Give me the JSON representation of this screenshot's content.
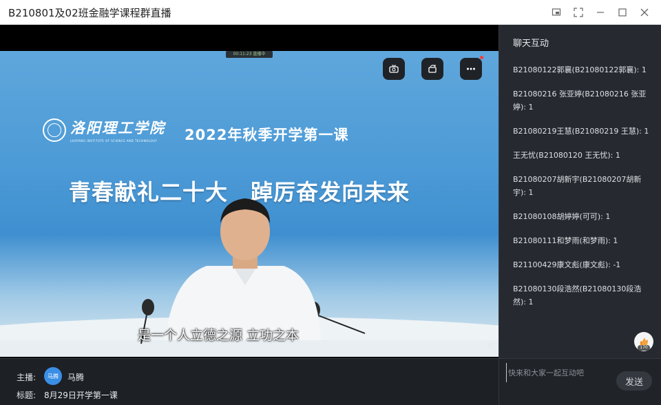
{
  "window": {
    "title": "B210801及02班金融学课程群直播",
    "controls": [
      "popout-icon",
      "fullscreen-icon",
      "minimize-icon",
      "maximize-icon",
      "close-icon"
    ]
  },
  "video": {
    "slide": {
      "logo_cn": "洛阳理工学院",
      "logo_en": "LUOYANG INSTITUTE OF SCIENCE AND TECHNOLOGY",
      "headline_1": "2022年秋季开学第一课",
      "headline_2": "青春献礼二十大　踔厉奋发向未来"
    },
    "subtitle": "是一个人立德之源 立功之本",
    "badge_text": "00:11:23 直播中",
    "watermark": "WI",
    "overlay_buttons": [
      "camera-flip-icon",
      "rotate-screen-icon",
      "more-icon"
    ]
  },
  "host": {
    "label": "主播:",
    "avatar_text": "马腾",
    "name": "马腾",
    "topic_label": "标题:",
    "topic": "8月29日开学第一课"
  },
  "chat": {
    "title": "聊天互动",
    "messages": [
      "B21080122郭襄(B21080122郭襄): 1",
      "B21080216 张亚婷(B21080216 张亚婷): 1",
      "B21080219王慧(B21080219 王慧): 1",
      "王无忧(B21080120 王无忧): 1",
      "B21080207胡新宇(B21080207胡新宇): 1",
      "B21080108胡婷婷(可可): 1",
      "B21080111和梦雨(和梦雨): 1",
      "B21100429康文彪(康文彪): -1",
      "B21080130段浩然(B21080130段浩然): 1"
    ],
    "like_count": "170",
    "input_placeholder": "快来和大家一起互动吧",
    "send_label": "发送"
  },
  "colors": {
    "accent": "#3a8ee6",
    "chat_bg": "#262a30",
    "stage_blue": "#4c9ad6"
  }
}
